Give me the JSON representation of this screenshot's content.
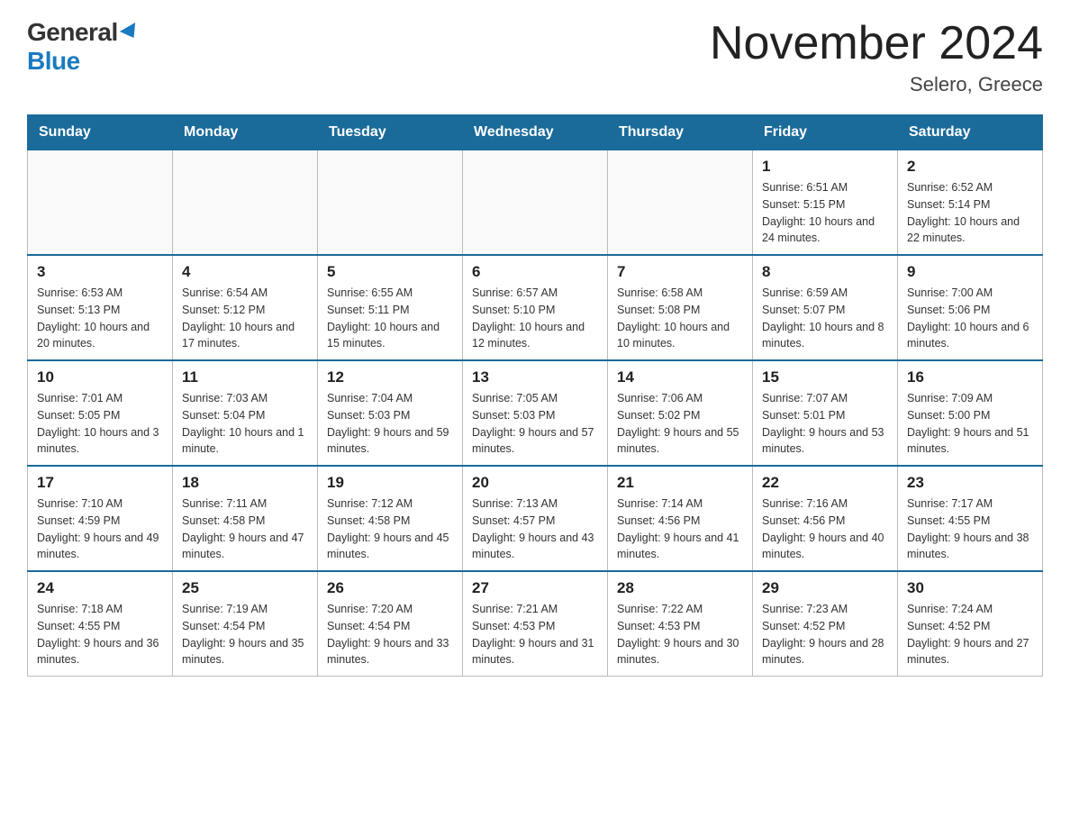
{
  "logo": {
    "general": "General",
    "blue": "Blue"
  },
  "title": "November 2024",
  "subtitle": "Selero, Greece",
  "days_of_week": [
    "Sunday",
    "Monday",
    "Tuesday",
    "Wednesday",
    "Thursday",
    "Friday",
    "Saturday"
  ],
  "weeks": [
    [
      {
        "day": "",
        "sunrise": "",
        "sunset": "",
        "daylight": ""
      },
      {
        "day": "",
        "sunrise": "",
        "sunset": "",
        "daylight": ""
      },
      {
        "day": "",
        "sunrise": "",
        "sunset": "",
        "daylight": ""
      },
      {
        "day": "",
        "sunrise": "",
        "sunset": "",
        "daylight": ""
      },
      {
        "day": "",
        "sunrise": "",
        "sunset": "",
        "daylight": ""
      },
      {
        "day": "1",
        "sunrise": "Sunrise: 6:51 AM",
        "sunset": "Sunset: 5:15 PM",
        "daylight": "Daylight: 10 hours and 24 minutes."
      },
      {
        "day": "2",
        "sunrise": "Sunrise: 6:52 AM",
        "sunset": "Sunset: 5:14 PM",
        "daylight": "Daylight: 10 hours and 22 minutes."
      }
    ],
    [
      {
        "day": "3",
        "sunrise": "Sunrise: 6:53 AM",
        "sunset": "Sunset: 5:13 PM",
        "daylight": "Daylight: 10 hours and 20 minutes."
      },
      {
        "day": "4",
        "sunrise": "Sunrise: 6:54 AM",
        "sunset": "Sunset: 5:12 PM",
        "daylight": "Daylight: 10 hours and 17 minutes."
      },
      {
        "day": "5",
        "sunrise": "Sunrise: 6:55 AM",
        "sunset": "Sunset: 5:11 PM",
        "daylight": "Daylight: 10 hours and 15 minutes."
      },
      {
        "day": "6",
        "sunrise": "Sunrise: 6:57 AM",
        "sunset": "Sunset: 5:10 PM",
        "daylight": "Daylight: 10 hours and 12 minutes."
      },
      {
        "day": "7",
        "sunrise": "Sunrise: 6:58 AM",
        "sunset": "Sunset: 5:08 PM",
        "daylight": "Daylight: 10 hours and 10 minutes."
      },
      {
        "day": "8",
        "sunrise": "Sunrise: 6:59 AM",
        "sunset": "Sunset: 5:07 PM",
        "daylight": "Daylight: 10 hours and 8 minutes."
      },
      {
        "day": "9",
        "sunrise": "Sunrise: 7:00 AM",
        "sunset": "Sunset: 5:06 PM",
        "daylight": "Daylight: 10 hours and 6 minutes."
      }
    ],
    [
      {
        "day": "10",
        "sunrise": "Sunrise: 7:01 AM",
        "sunset": "Sunset: 5:05 PM",
        "daylight": "Daylight: 10 hours and 3 minutes."
      },
      {
        "day": "11",
        "sunrise": "Sunrise: 7:03 AM",
        "sunset": "Sunset: 5:04 PM",
        "daylight": "Daylight: 10 hours and 1 minute."
      },
      {
        "day": "12",
        "sunrise": "Sunrise: 7:04 AM",
        "sunset": "Sunset: 5:03 PM",
        "daylight": "Daylight: 9 hours and 59 minutes."
      },
      {
        "day": "13",
        "sunrise": "Sunrise: 7:05 AM",
        "sunset": "Sunset: 5:03 PM",
        "daylight": "Daylight: 9 hours and 57 minutes."
      },
      {
        "day": "14",
        "sunrise": "Sunrise: 7:06 AM",
        "sunset": "Sunset: 5:02 PM",
        "daylight": "Daylight: 9 hours and 55 minutes."
      },
      {
        "day": "15",
        "sunrise": "Sunrise: 7:07 AM",
        "sunset": "Sunset: 5:01 PM",
        "daylight": "Daylight: 9 hours and 53 minutes."
      },
      {
        "day": "16",
        "sunrise": "Sunrise: 7:09 AM",
        "sunset": "Sunset: 5:00 PM",
        "daylight": "Daylight: 9 hours and 51 minutes."
      }
    ],
    [
      {
        "day": "17",
        "sunrise": "Sunrise: 7:10 AM",
        "sunset": "Sunset: 4:59 PM",
        "daylight": "Daylight: 9 hours and 49 minutes."
      },
      {
        "day": "18",
        "sunrise": "Sunrise: 7:11 AM",
        "sunset": "Sunset: 4:58 PM",
        "daylight": "Daylight: 9 hours and 47 minutes."
      },
      {
        "day": "19",
        "sunrise": "Sunrise: 7:12 AM",
        "sunset": "Sunset: 4:58 PM",
        "daylight": "Daylight: 9 hours and 45 minutes."
      },
      {
        "day": "20",
        "sunrise": "Sunrise: 7:13 AM",
        "sunset": "Sunset: 4:57 PM",
        "daylight": "Daylight: 9 hours and 43 minutes."
      },
      {
        "day": "21",
        "sunrise": "Sunrise: 7:14 AM",
        "sunset": "Sunset: 4:56 PM",
        "daylight": "Daylight: 9 hours and 41 minutes."
      },
      {
        "day": "22",
        "sunrise": "Sunrise: 7:16 AM",
        "sunset": "Sunset: 4:56 PM",
        "daylight": "Daylight: 9 hours and 40 minutes."
      },
      {
        "day": "23",
        "sunrise": "Sunrise: 7:17 AM",
        "sunset": "Sunset: 4:55 PM",
        "daylight": "Daylight: 9 hours and 38 minutes."
      }
    ],
    [
      {
        "day": "24",
        "sunrise": "Sunrise: 7:18 AM",
        "sunset": "Sunset: 4:55 PM",
        "daylight": "Daylight: 9 hours and 36 minutes."
      },
      {
        "day": "25",
        "sunrise": "Sunrise: 7:19 AM",
        "sunset": "Sunset: 4:54 PM",
        "daylight": "Daylight: 9 hours and 35 minutes."
      },
      {
        "day": "26",
        "sunrise": "Sunrise: 7:20 AM",
        "sunset": "Sunset: 4:54 PM",
        "daylight": "Daylight: 9 hours and 33 minutes."
      },
      {
        "day": "27",
        "sunrise": "Sunrise: 7:21 AM",
        "sunset": "Sunset: 4:53 PM",
        "daylight": "Daylight: 9 hours and 31 minutes."
      },
      {
        "day": "28",
        "sunrise": "Sunrise: 7:22 AM",
        "sunset": "Sunset: 4:53 PM",
        "daylight": "Daylight: 9 hours and 30 minutes."
      },
      {
        "day": "29",
        "sunrise": "Sunrise: 7:23 AM",
        "sunset": "Sunset: 4:52 PM",
        "daylight": "Daylight: 9 hours and 28 minutes."
      },
      {
        "day": "30",
        "sunrise": "Sunrise: 7:24 AM",
        "sunset": "Sunset: 4:52 PM",
        "daylight": "Daylight: 9 hours and 27 minutes."
      }
    ]
  ]
}
